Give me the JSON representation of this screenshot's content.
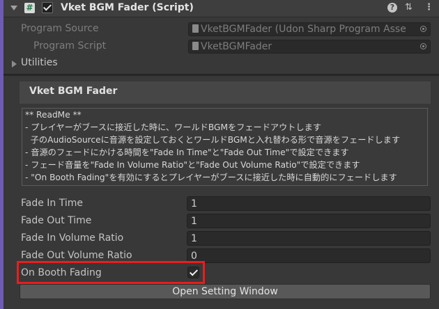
{
  "header": {
    "component_name": "Vket BGM Fader (Script)",
    "script_icon": "#",
    "icons": [
      "foldout-arrow-icon",
      "csharp-script-icon",
      "enabled-checkbox",
      "help-icon",
      "presets-icon",
      "more-options-icon"
    ]
  },
  "program_source": {
    "label": "Program Source",
    "value": "VketBGMFader (Udon Sharp Program Asse"
  },
  "program_script": {
    "label": "Program Script",
    "value": "VketBGMFader"
  },
  "utilities": {
    "label": "Utilities"
  },
  "fader_panel": {
    "title": "Vket BGM Fader"
  },
  "readme": {
    "lines": [
      "** ReadMe **",
      "- プレイヤーがブースに接近した時に、ワールドBGMをフェードアウトします",
      "  子のAudioSourceに音源を設定しておくとワールドBGMと入れ替わる形で音源をフェードします",
      "- 音源のフェードにかける時間を\"Fade In Time\"と\"Fade Out Time\"で設定できます",
      "- フェード音量を\"Fade In Volume Ratio\"と\"Fade Out Volume Ratio\"で設定できます",
      "- \"On Booth Fading\"を有効にするとプレイヤーがブースに接近した時に自動的にフェードします"
    ]
  },
  "fields": {
    "fade_in_time": {
      "label": "Fade In Time",
      "value": "1"
    },
    "fade_out_time": {
      "label": "Fade Out Time",
      "value": "1"
    },
    "fade_in_volume_ratio": {
      "label": "Fade In Volume Ratio",
      "value": "1"
    },
    "fade_out_volume_ratio": {
      "label": "Fade Out Volume Ratio",
      "value": "0"
    }
  },
  "on_booth_fading": {
    "label": "On Booth Fading",
    "checked": true
  },
  "open_setting_window": {
    "label": "Open Setting Window"
  },
  "colors": {
    "highlight": "#e81e1e",
    "accent_bar": "#6e5cb0",
    "background": "#383838"
  }
}
